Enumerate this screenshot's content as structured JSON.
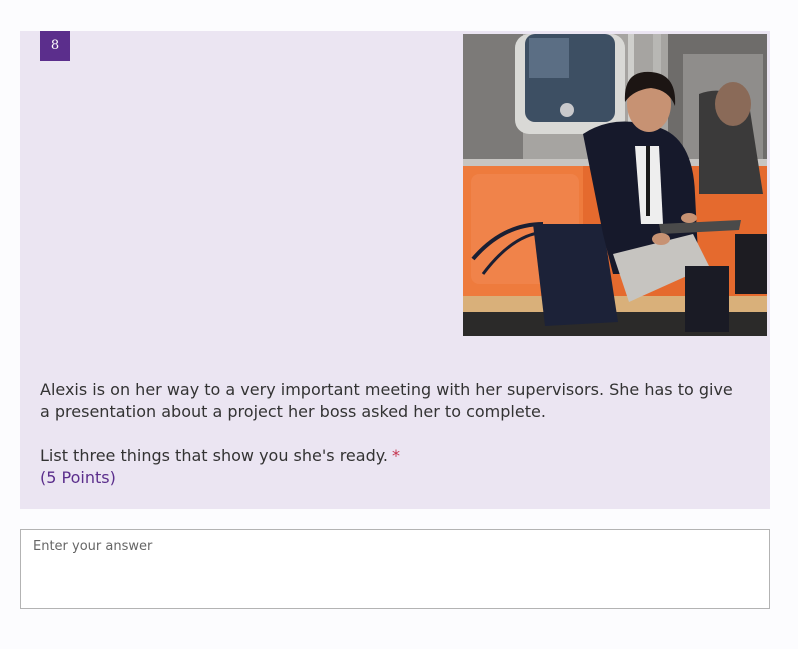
{
  "question": {
    "number": "8",
    "image_alt": "Woman in dark coat sitting on subway train seat reading papers",
    "description": "Alexis is on her way to a very important meeting with her supervisors. She has to give a presentation about a project her boss asked her to complete.",
    "prompt": "List three things that show you she's ready.",
    "required_mark": "*",
    "points": "(5 Points)"
  },
  "answer": {
    "placeholder": "Enter your answer",
    "value": ""
  },
  "colors": {
    "accent": "#5b2e8c",
    "card_background": "#ebe5f2",
    "required": "#c4314b"
  }
}
